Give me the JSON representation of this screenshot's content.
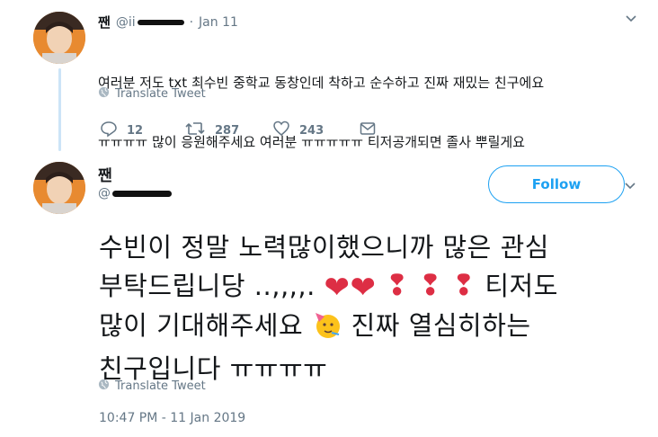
{
  "tweet1": {
    "name": "짼",
    "handle": "@ii",
    "separator": "·",
    "date": "Jan 11",
    "text_line1": "여러분 저도 txt 최수빈 중학교 동창인데 착하고 순수하고 진짜 재밌는 친구에요",
    "text_line2": "ㅠㅠㅠㅠ 많이 응원해주세요 여러분 ㅠㅠㅠㅠㅠ 티저공개되면 졸사 뿌릴게요",
    "translate_label": "Translate Tweet",
    "replies": "12",
    "retweets": "287",
    "likes": "243"
  },
  "tweet2": {
    "name": "짼",
    "handle": "@",
    "follow_label": "Follow",
    "text": {
      "line1": "수빈이 정말 노력많이했으니까 많은 관심",
      "line2_a": "부탁드립니당 ..,,,,.",
      "line2_b": "티저도",
      "line3_a": "많이 기대해주세요",
      "line3_b": "진짜 열심히하는",
      "line4": "친구입니다 ㅠㅠㅠㅠ"
    },
    "hearts": [
      "❤",
      "❤"
    ],
    "exclamations": [
      "❢",
      "❢",
      "❢"
    ],
    "party_emoji": "🥳",
    "translate_label": "Translate Tweet",
    "timestamp": "10:47 PM - 11 Jan 2019"
  },
  "icons": {
    "reply": "reply-icon",
    "retweet": "retweet-icon",
    "like": "heart-outline-icon",
    "dm": "envelope-icon",
    "globe": "globe-icon",
    "chevron": "chevron-down-icon"
  },
  "colors": {
    "accent": "#1da1f2",
    "muted": "#657786",
    "red_emoji": "#dd2e44",
    "thread": "#cce4f7"
  }
}
